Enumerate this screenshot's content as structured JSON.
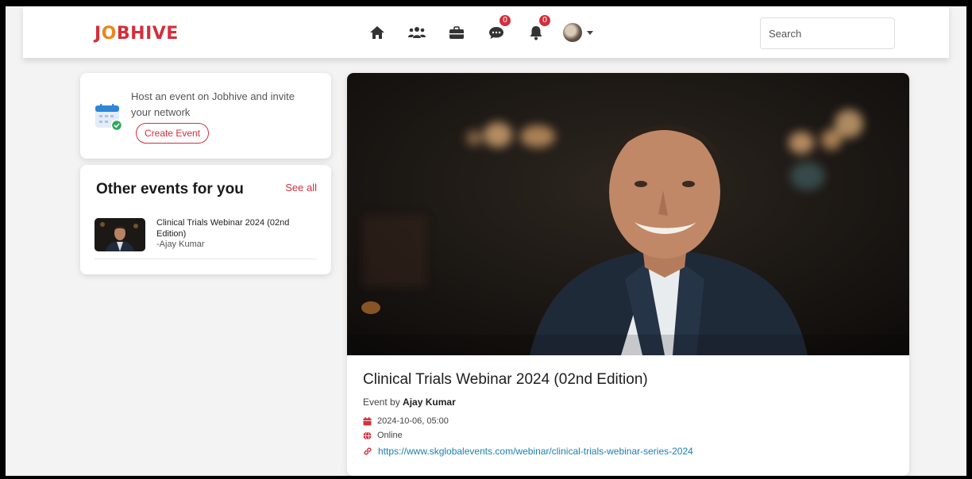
{
  "brand": {
    "logo_prefix": "J",
    "logo_o": "O",
    "logo_suffix": "BHIVE"
  },
  "nav": {
    "icons": [
      "home-icon",
      "network-icon",
      "jobs-icon",
      "messages-icon",
      "notifications-icon"
    ],
    "messages_badge": "0",
    "notifications_badge": "0"
  },
  "search": {
    "placeholder": "Search"
  },
  "host_card": {
    "text": "Host an event on Jobhive and invite your network",
    "button_label": "Create Event"
  },
  "other_events": {
    "title": "Other events for you",
    "see_all": "See all",
    "items": [
      {
        "title": "Clinical Trials Webinar 2024 (02nd Edition)",
        "author": "-Ajay Kumar"
      }
    ]
  },
  "event": {
    "title": "Clinical Trials Webinar 2024 (02nd Edition)",
    "by_label": "Event by",
    "organizer": "Ajay Kumar",
    "datetime": "2024-10-06, 05:00",
    "mode": "Online",
    "url": "https://www.skglobalevents.com/webinar/clinical-trials-webinar-series-2024"
  },
  "colors": {
    "accent": "#d32f3d",
    "link": "#1b7fae",
    "logo_o": "#e8881a"
  }
}
